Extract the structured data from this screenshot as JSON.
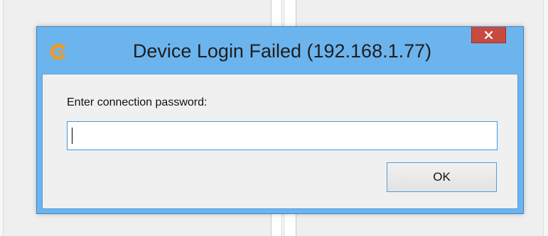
{
  "dialog": {
    "title": "Device Login Failed (192.168.1.77)",
    "prompt": "Enter connection password:",
    "password_value": "",
    "ok_label": "OK",
    "close_glyph": "✕",
    "app_icon": "app-logo-icon"
  },
  "colors": {
    "frame": "#6cb4ee",
    "close_button": "#c74a3f",
    "client_background": "#f0f0f0",
    "input_border": "#3d9be0",
    "icon_orange": "#f39a1e"
  }
}
